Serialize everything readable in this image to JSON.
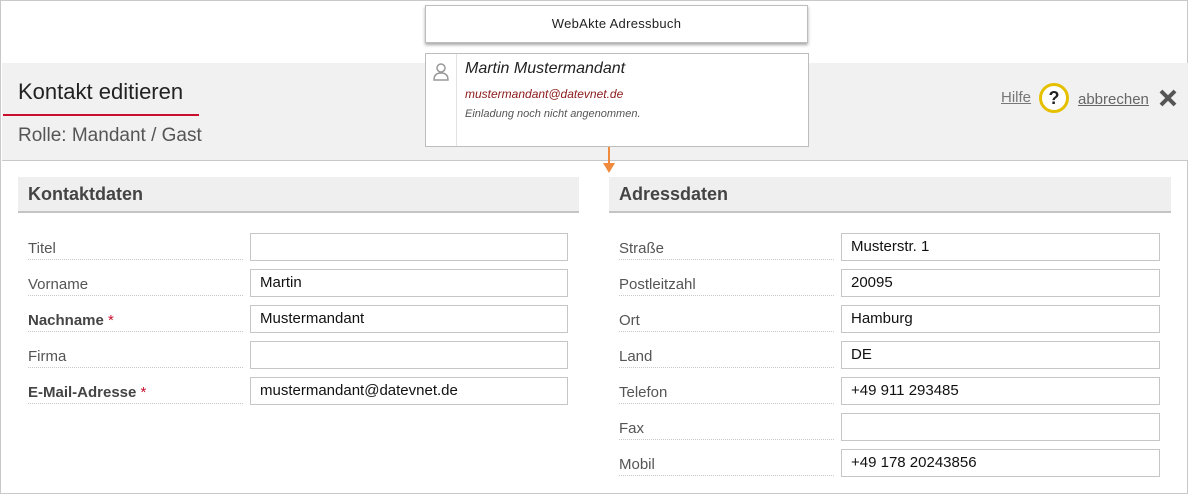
{
  "webakte": {
    "button_label": "WebAkte Adressbuch"
  },
  "card": {
    "name": "Martin Mustermandant",
    "email": "mustermandant@datevnet.de",
    "status": "Einladung noch nicht angenommen."
  },
  "header": {
    "title": "Kontakt editieren",
    "role": "Rolle: Mandant / Gast",
    "help_label": "Hilfe",
    "help_glyph": "?",
    "cancel_label": "abbrechen",
    "accent_color": "#c8102e",
    "help_icon_color": "#e5c000"
  },
  "contact": {
    "heading": "Kontaktdaten",
    "fields": [
      {
        "label": "Titel",
        "value": "",
        "required": false
      },
      {
        "label": "Vorname",
        "value": "Martin",
        "required": false
      },
      {
        "label": "Nachname",
        "value": "Mustermandant",
        "required": true
      },
      {
        "label": "Firma",
        "value": "",
        "required": false
      },
      {
        "label": "E-Mail-Adresse",
        "value": "mustermandant@datevnet.de",
        "required": true
      }
    ]
  },
  "address": {
    "heading": "Adressdaten",
    "fields": [
      {
        "label": "Straße",
        "value": "Musterstr. 1"
      },
      {
        "label": "Postleitzahl",
        "value": "20095"
      },
      {
        "label": "Ort",
        "value": "Hamburg"
      },
      {
        "label": "Land",
        "value": "DE"
      },
      {
        "label": "Telefon",
        "value": "+49 911 293485"
      },
      {
        "label": "Fax",
        "value": ""
      },
      {
        "label": "Mobil",
        "value": "+49 178 20243856"
      }
    ]
  },
  "required_marker": "*"
}
